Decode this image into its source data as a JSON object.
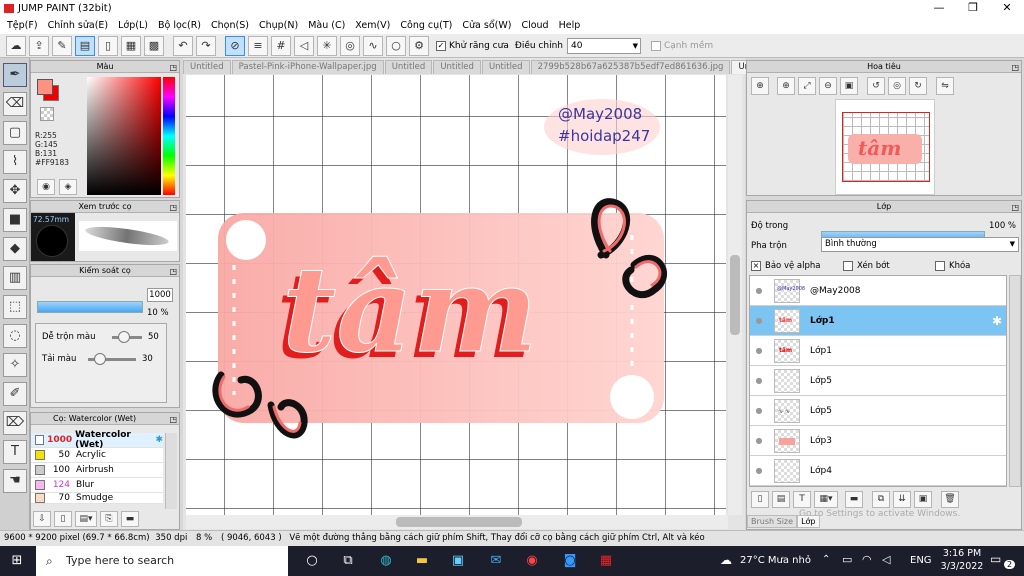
{
  "app": {
    "title": "JUMP PAINT (32bit)"
  },
  "menu": [
    "Tệp(F)",
    "Chỉnh sửa(E)",
    "Lớp(L)",
    "Bộ lọc(R)",
    "Chọn(S)",
    "Chụp(N)",
    "Màu (C)",
    "Xem(V)",
    "Công cụ(T)",
    "Cửa sổ(W)",
    "Cloud",
    "Help"
  ],
  "toolbar": {
    "antialias_label": "Khử răng cưa",
    "adjust_label": "Điều chỉnh",
    "adjust_value": "40",
    "edge_label": "Cạnh mềm"
  },
  "color_panel": {
    "title": "Màu",
    "r": "R:255",
    "g": "G:145",
    "b": "B:131",
    "hex": "#FF9183",
    "primary": "#ff9183",
    "secondary": "#ee1111"
  },
  "brush_preview": {
    "title": "Xem trước cọ",
    "size": "72.57mm"
  },
  "brush_control": {
    "title": "Kiểm soát cọ",
    "size_value": "1000",
    "opacity_value": "10 %",
    "opacity_fraction": 0.1,
    "blend_label": "Dễ trộn màu",
    "blend_value": "50",
    "mix_label": "Tải màu",
    "mix_value": "30"
  },
  "brush_list": {
    "title": "Cọ: Watercolor (Wet)",
    "items": [
      {
        "num": "1000",
        "name": "Watercolor (Wet)",
        "color": "#ffffff"
      },
      {
        "num": "50",
        "name": "Acrylic",
        "color": "#f2e400"
      },
      {
        "num": "100",
        "name": "Airbrush",
        "color": "#cccccc"
      },
      {
        "num": "124",
        "name": "Blur",
        "color": "#f5b8f0"
      },
      {
        "num": "70",
        "name": "Smudge",
        "color": "#f8dcc8"
      }
    ]
  },
  "tabs": [
    {
      "label": "Untitled",
      "active": false
    },
    {
      "label": "Pastel-Pink-iPhone-Wallpaper.jpg",
      "active": false
    },
    {
      "label": "Untitled",
      "active": false
    },
    {
      "label": "Untitled",
      "active": false
    },
    {
      "label": "Untitled",
      "active": false
    },
    {
      "label": "2799b528b67a625387b5edf7ed861636.jpg",
      "active": false
    },
    {
      "label": "Untitled",
      "active": true
    }
  ],
  "canvas": {
    "handle": "@May2008",
    "tag": "#hoidap247",
    "word": "tâm"
  },
  "navigator": {
    "title": "Hoa tiêu"
  },
  "layers": {
    "title": "Lớp",
    "opacity_label": "Độ trong",
    "opacity_value": "100 %",
    "opacity_fraction": 1.0,
    "blend_label": "Pha trộn",
    "blend_value": "Bình thường",
    "protect_alpha": "Bảo vệ alpha",
    "clip": "Xén bớt",
    "lock": "Khóa",
    "items": [
      {
        "name": "@May2008",
        "selected": false
      },
      {
        "name": "Lớp1",
        "selected": true
      },
      {
        "name": "Lớp1",
        "selected": false
      },
      {
        "name": "Lớp5",
        "selected": false
      },
      {
        "name": "Lớp5",
        "selected": false
      },
      {
        "name": "Lớp3",
        "selected": false
      },
      {
        "name": "Lớp4",
        "selected": false
      }
    ],
    "bottom_tabs": [
      "Brush Size",
      "Lớp"
    ],
    "watermark": "Go to Settings to activate Windows."
  },
  "status": {
    "size": "9600 * 9200 pixel",
    "mm": "(69.7 * 66.8cm)",
    "dpi": "350 dpi",
    "zoom": "8 %",
    "coords": "( 9046, 6043 )",
    "hint": "Vẽ một đường thẳng bằng cách giữ phím Shift, Thay đổi cỡ cọ bằng cách giữ phím Ctrl, Alt và kéo"
  },
  "taskbar": {
    "search": "Type here to search",
    "weather": "27°C  Mưa nhỏ",
    "lang": "ENG",
    "time": "3:16 PM",
    "date": "3/3/2022",
    "notif": "2"
  }
}
